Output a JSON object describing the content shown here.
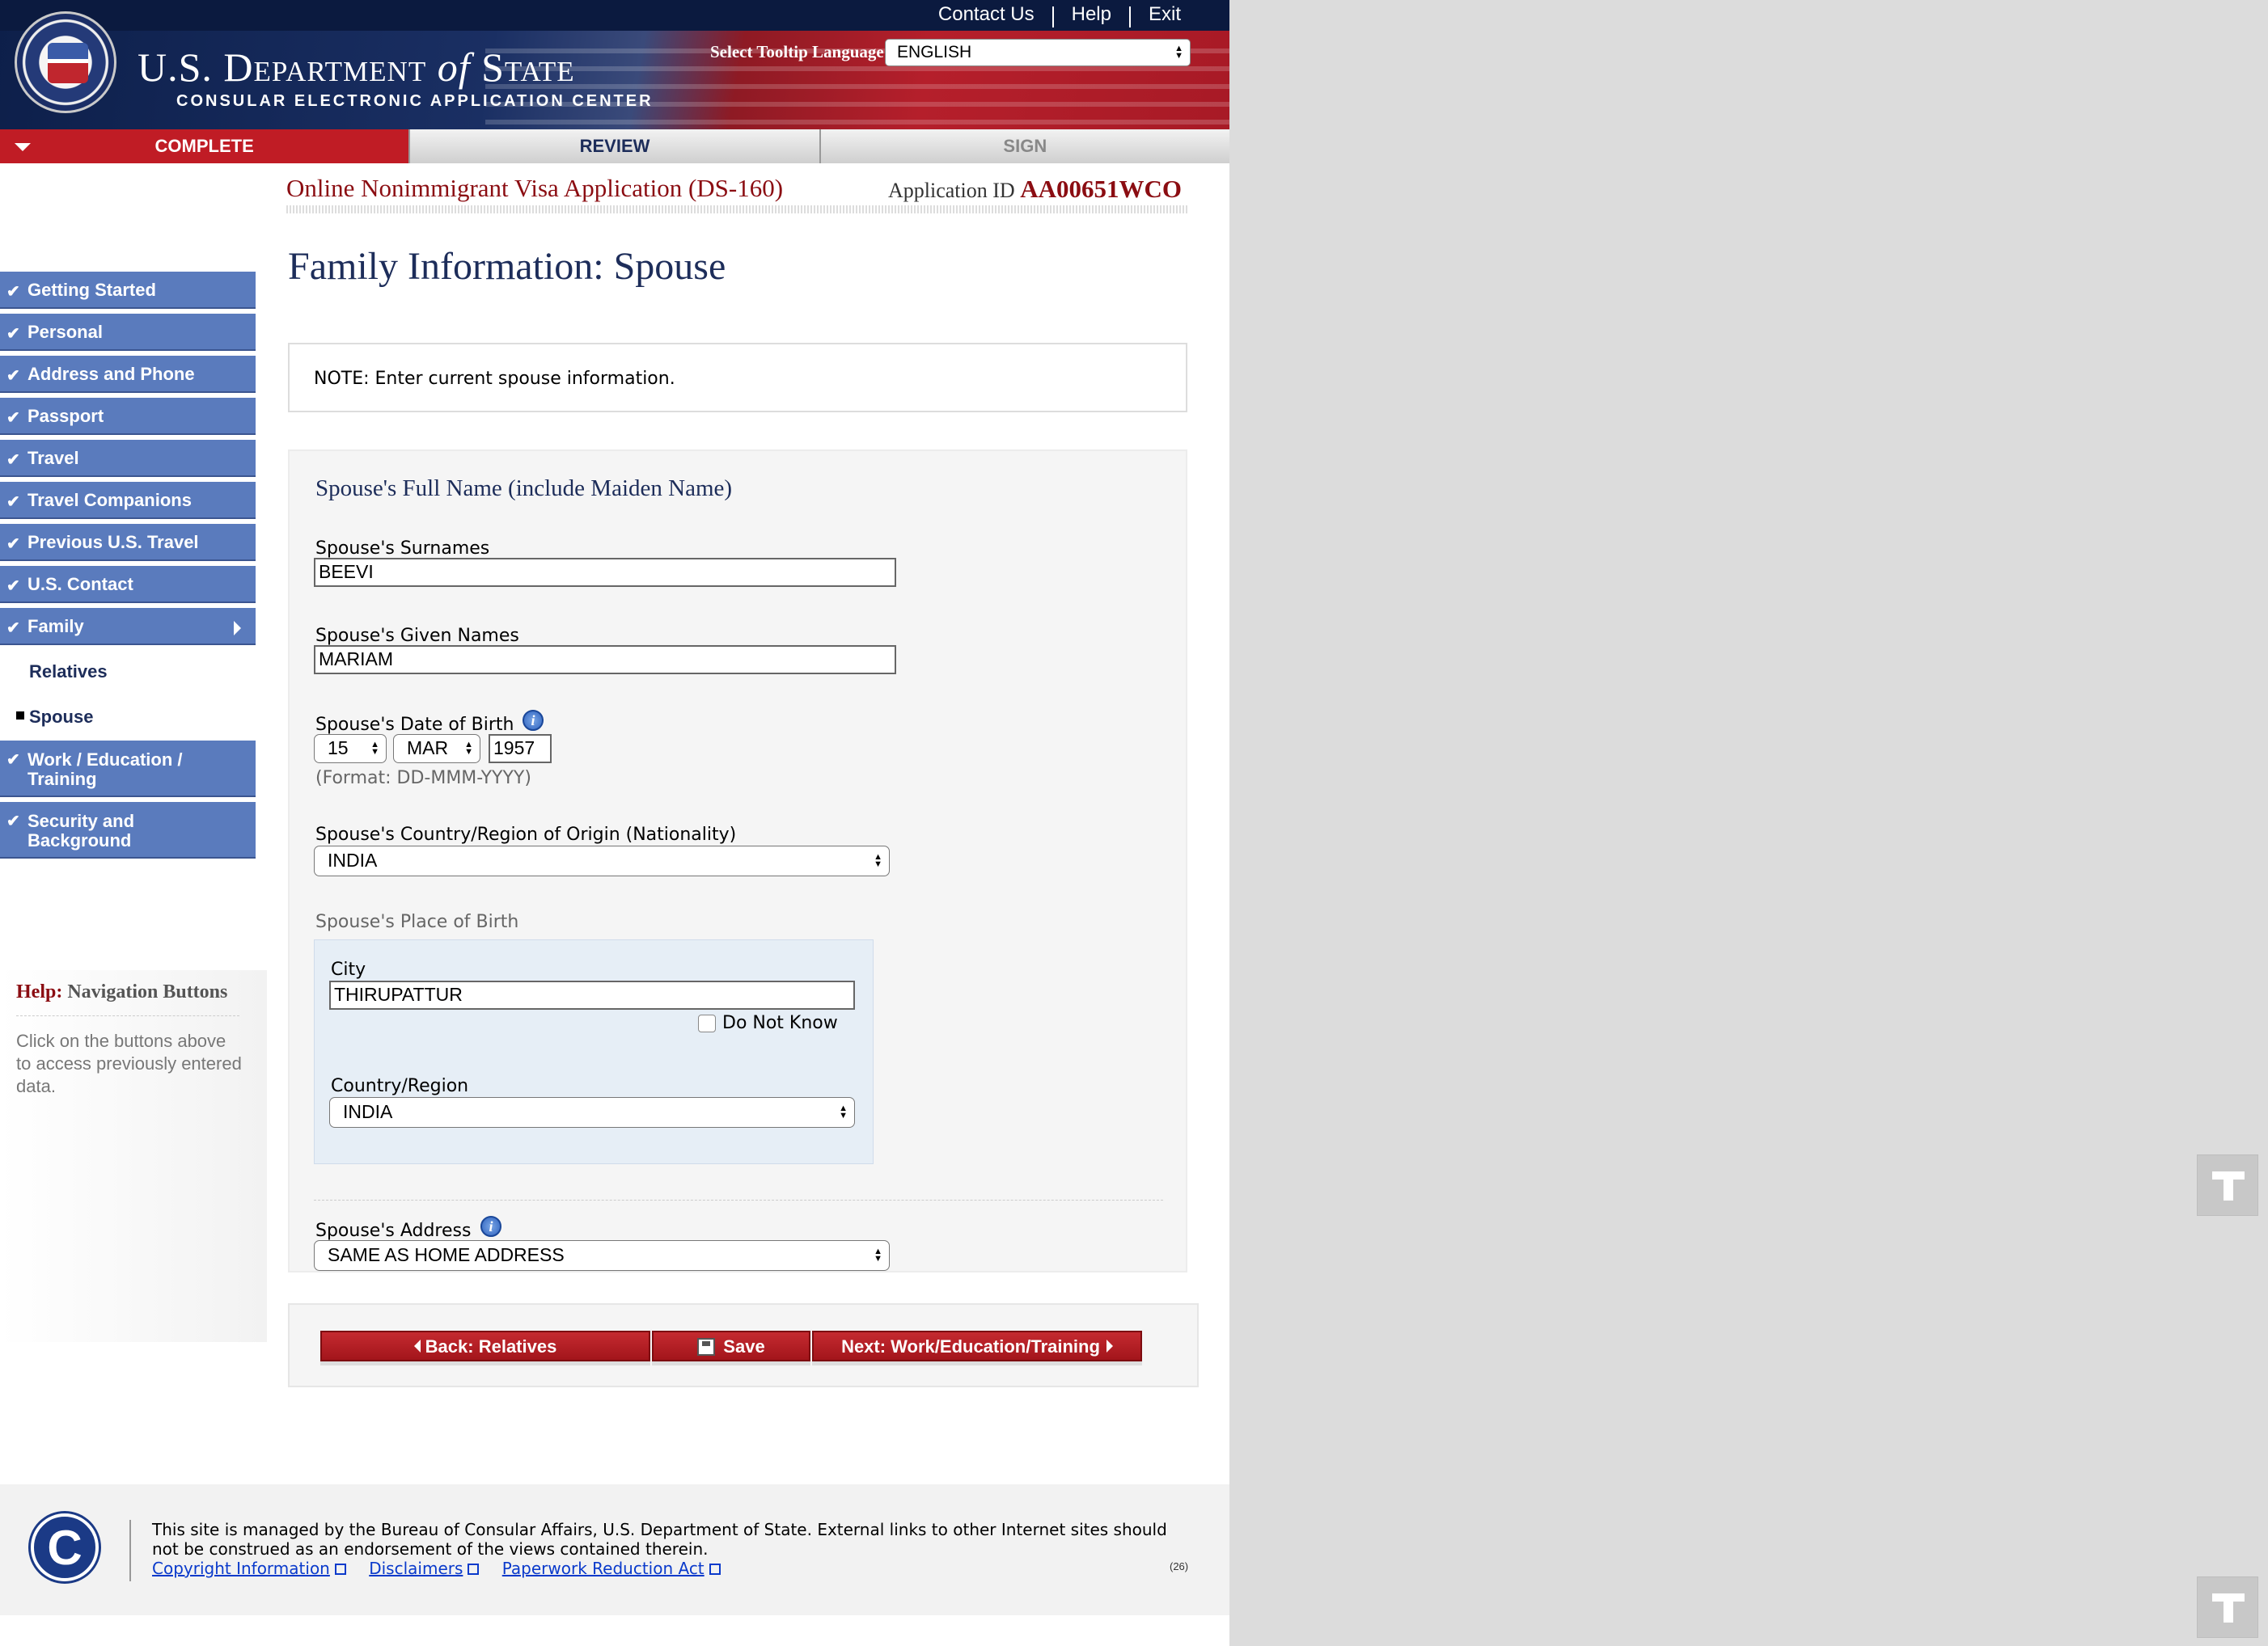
{
  "header": {
    "title_pre": "U.S. Department ",
    "title_of": "of",
    "title_post": " State",
    "subtitle": "CONSULAR ELECTRONIC APPLICATION CENTER",
    "links": [
      "Contact Us",
      "Help",
      "Exit"
    ],
    "tooltip_label": "Select Tooltip Language",
    "tooltip_value": "ENGLISH"
  },
  "tabs": [
    {
      "label": "COMPLETE",
      "state": "active"
    },
    {
      "label": "REVIEW",
      "state": "inactive"
    },
    {
      "label": "SIGN",
      "state": "disabled"
    }
  ],
  "form": {
    "title": "Online Nonimmigrant Visa Application (DS-160)",
    "app_id_label": "Application ID",
    "app_id_value": "AA00651WCO"
  },
  "sidebar": {
    "items": [
      {
        "label": "Getting Started"
      },
      {
        "label": "Personal"
      },
      {
        "label": "Address and Phone"
      },
      {
        "label": "Passport"
      },
      {
        "label": "Travel"
      },
      {
        "label": "Travel Companions"
      },
      {
        "label": "Previous U.S. Travel"
      },
      {
        "label": "U.S. Contact"
      },
      {
        "label": "Family"
      }
    ],
    "subitems": [
      {
        "label": "Relatives"
      },
      {
        "label": "Spouse"
      }
    ],
    "items_after": [
      {
        "label": "Work / Education / Training"
      },
      {
        "label": "Security and Background"
      }
    ]
  },
  "help": {
    "prefix": "Help:",
    "title": "Navigation Buttons",
    "text": "Click on the buttons above to access previously entered data."
  },
  "main": {
    "heading": "Family Information: Spouse",
    "note": "NOTE: Enter current spouse information.",
    "section_title": "Spouse's Full Name (include Maiden Name)",
    "surnames_label": "Spouse's Surnames",
    "surnames_value": "BEEVI",
    "given_label": "Spouse's Given Names",
    "given_value": "MARIAM",
    "dob_label": "Spouse's Date of Birth",
    "dob_day": "15",
    "dob_month": "MAR",
    "dob_year": "1957",
    "dob_format": "(Format: DD-MMM-YYYY)",
    "nationality_label": "Spouse's Country/Region of Origin (Nationality)",
    "nationality_value": "INDIA",
    "pob_label": "Spouse's Place of Birth",
    "city_label": "City",
    "city_value": "THIRUPATTUR",
    "do_not_know": "Do Not Know",
    "country_label": "Country/Region",
    "country_value": "INDIA",
    "address_label": "Spouse's Address",
    "address_value": "SAME AS HOME ADDRESS"
  },
  "buttons": {
    "back": "Back: Relatives",
    "save": "Save",
    "next": "Next: Work/Education/Training"
  },
  "footer": {
    "text": "This site is managed by the Bureau of Consular Affairs, U.S. Department of State. External links to other Internet sites should not be construed as an endorsement of the views contained therein.",
    "links": [
      "Copyright Information",
      "Disclaimers",
      "Paperwork Reduction Act"
    ],
    "page_num": "(26)",
    "logo_letter": "C"
  },
  "colors": {
    "nav_blue": "#5a7bbd",
    "accent_red": "#c01c25",
    "heading_navy": "#1d2d5a"
  }
}
